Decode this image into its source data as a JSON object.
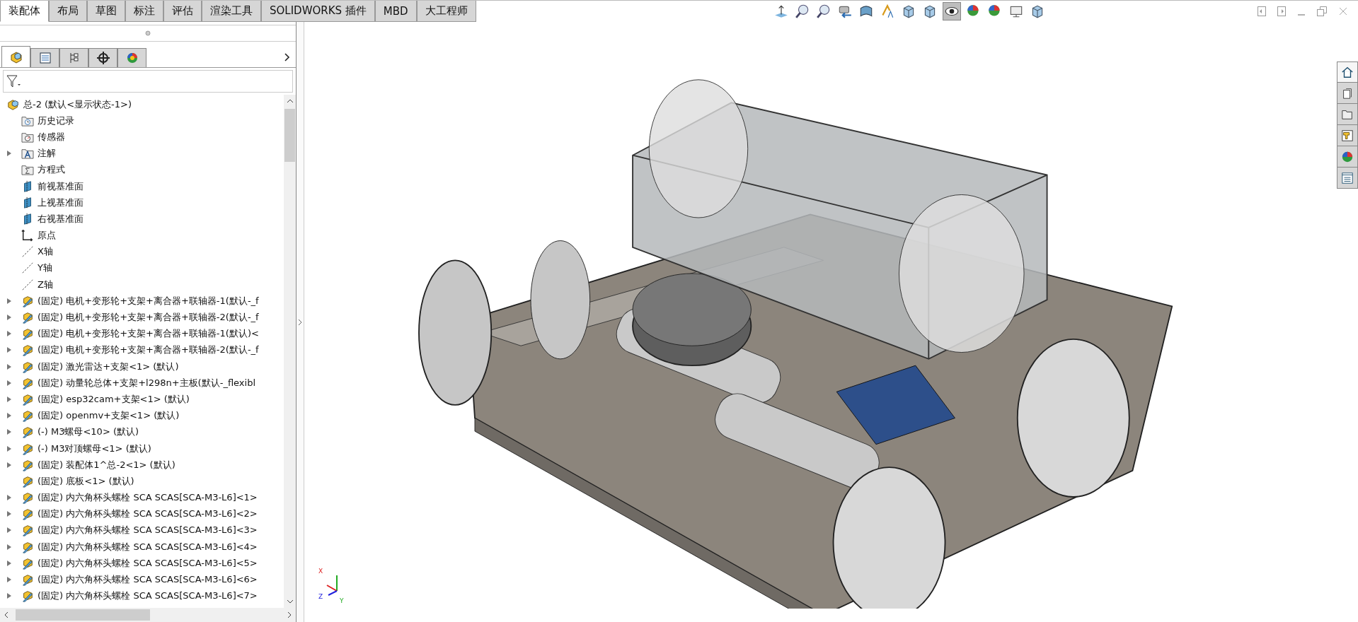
{
  "command_tabs": [
    {
      "label": "装配体",
      "selected": true
    },
    {
      "label": "布局",
      "selected": false
    },
    {
      "label": "草图",
      "selected": false
    },
    {
      "label": "标注",
      "selected": false
    },
    {
      "label": "评估",
      "selected": false
    },
    {
      "label": "渲染工具",
      "selected": false
    },
    {
      "label": "SOLIDWORKS 插件",
      "selected": false
    },
    {
      "label": "MBD",
      "selected": false
    },
    {
      "label": "大工程师",
      "selected": false
    }
  ],
  "panel_tabs": [
    {
      "kind": "feature-tree",
      "selected": true
    },
    {
      "kind": "property",
      "selected": false
    },
    {
      "kind": "config",
      "selected": false
    },
    {
      "kind": "dimxpert",
      "selected": false
    },
    {
      "kind": "display",
      "selected": false
    }
  ],
  "tree": {
    "label": "总-2  (默认<显示状态-1>)",
    "children": [
      {
        "kind": "history",
        "label": "历史记录",
        "expandable": false
      },
      {
        "kind": "sensors",
        "label": "传感器",
        "expandable": false
      },
      {
        "kind": "annotations",
        "label": "注解",
        "expandable": true
      },
      {
        "kind": "equations",
        "label": "方程式",
        "expandable": false
      },
      {
        "kind": "plane",
        "label": "前视基准面",
        "expandable": false
      },
      {
        "kind": "plane",
        "label": "上视基准面",
        "expandable": false
      },
      {
        "kind": "plane",
        "label": "右视基准面",
        "expandable": false
      },
      {
        "kind": "origin",
        "label": "原点",
        "expandable": false
      },
      {
        "kind": "axis",
        "label": "X轴",
        "expandable": false
      },
      {
        "kind": "axis",
        "label": "Y轴",
        "expandable": false
      },
      {
        "kind": "axis",
        "label": "Z轴",
        "expandable": false
      },
      {
        "kind": "component",
        "label": "(固定) 电机+变形轮+支架+离合器+联轴器-1(默认-_f",
        "expandable": true
      },
      {
        "kind": "component",
        "label": "(固定) 电机+变形轮+支架+离合器+联轴器-2(默认-_f",
        "expandable": true
      },
      {
        "kind": "component",
        "label": "(固定) 电机+变形轮+支架+离合器+联轴器-1(默认)<",
        "expandable": true
      },
      {
        "kind": "component",
        "label": "(固定) 电机+变形轮+支架+离合器+联轴器-2(默认-_f",
        "expandable": true
      },
      {
        "kind": "component",
        "label": "(固定) 激光雷达+支架<1> (默认)",
        "expandable": true
      },
      {
        "kind": "component",
        "label": "(固定) 动量轮总体+支架+l298n+主板(默认-_flexibl",
        "expandable": true
      },
      {
        "kind": "component",
        "label": "(固定) esp32cam+支架<1> (默认)",
        "expandable": true
      },
      {
        "kind": "component",
        "label": "(固定) openmv+支架<1> (默认)",
        "expandable": true
      },
      {
        "kind": "component",
        "label": "(-) M3螺母<10> (默认)",
        "expandable": true
      },
      {
        "kind": "component",
        "label": "(-) M3对顶螺母<1> (默认)",
        "expandable": true
      },
      {
        "kind": "component",
        "label": "(固定) 装配体1^总-2<1> (默认)",
        "expandable": true
      },
      {
        "kind": "component",
        "label": "(固定) 底板<1> (默认)",
        "expandable": false
      },
      {
        "kind": "component",
        "label": "(固定) 内六角杯头螺栓 SCA SCAS[SCA-M3-L6]<1>",
        "expandable": true
      },
      {
        "kind": "component",
        "label": "(固定) 内六角杯头螺栓 SCA SCAS[SCA-M3-L6]<2>",
        "expandable": true
      },
      {
        "kind": "component",
        "label": "(固定) 内六角杯头螺栓 SCA SCAS[SCA-M3-L6]<3>",
        "expandable": true
      },
      {
        "kind": "component",
        "label": "(固定) 内六角杯头螺栓 SCA SCAS[SCA-M3-L6]<4>",
        "expandable": true
      },
      {
        "kind": "component",
        "label": "(固定) 内六角杯头螺栓 SCA SCAS[SCA-M3-L6]<5>",
        "expandable": true
      },
      {
        "kind": "component",
        "label": "(固定) 内六角杯头螺栓 SCA SCAS[SCA-M3-L6]<6>",
        "expandable": true
      },
      {
        "kind": "component",
        "label": "(固定) 内六角杯头螺栓 SCA SCAS[SCA-M3-L6]<7>",
        "expandable": true
      }
    ]
  },
  "triad": {
    "x": "X",
    "y": "Y",
    "z": "Z"
  }
}
